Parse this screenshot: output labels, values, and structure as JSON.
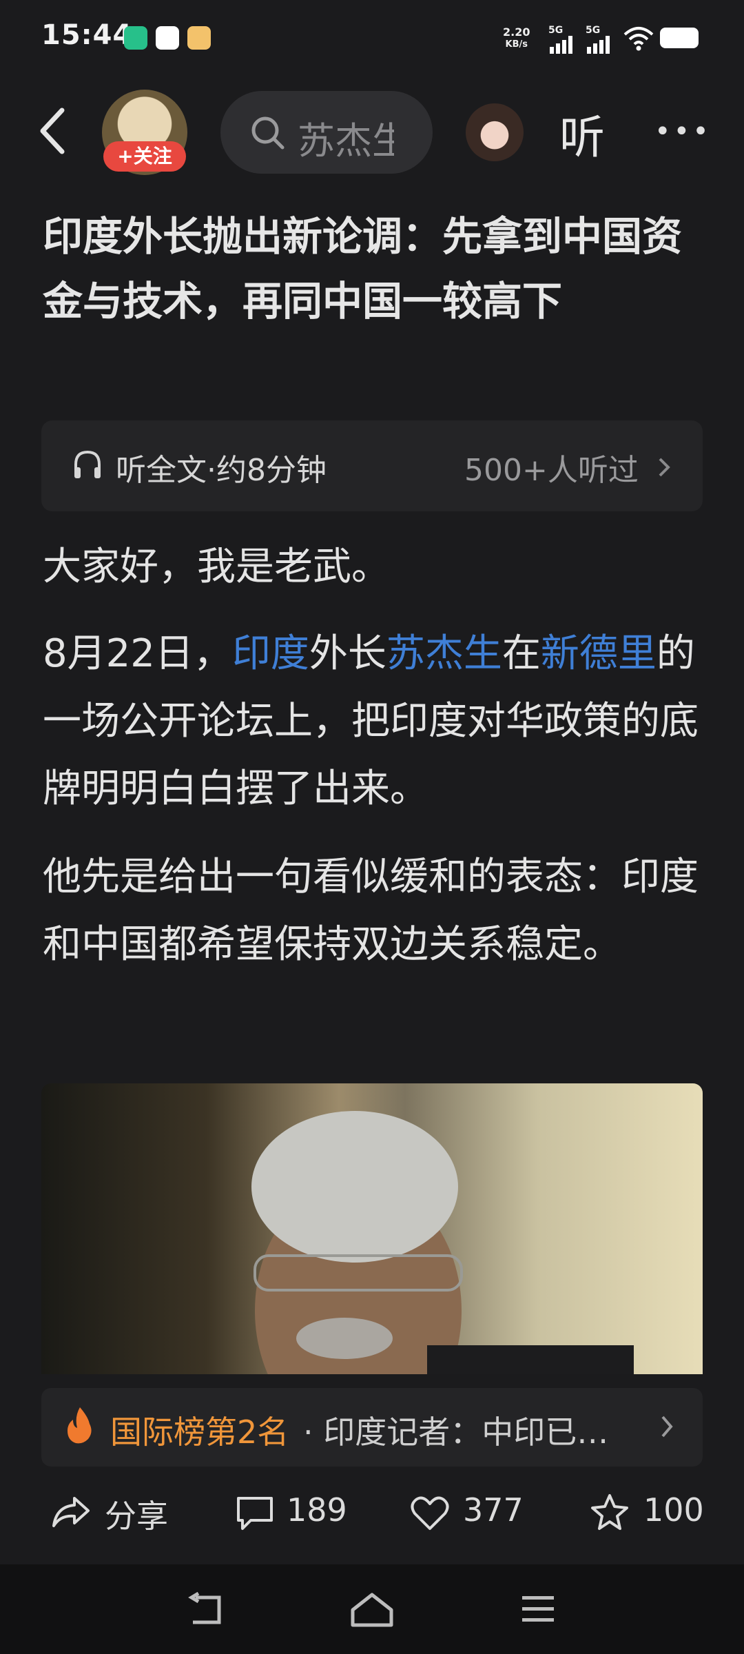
{
  "status_bar": {
    "time": "15:44",
    "net_speed_value": "2.20",
    "net_speed_unit": "KB/s",
    "signal1": "5G",
    "signal2": "5G",
    "battery_icon": "battery-icon"
  },
  "header": {
    "follow_label": "+关注",
    "search_text": "苏杰生",
    "listen_label": "听",
    "more_icon": "more-icon"
  },
  "article": {
    "title": "印度外长抛出新论调：先拿到中国资金与技术，再同中国一较高下",
    "audio_label": "听全文·约8分钟",
    "audio_count": "500+人听过",
    "para1": "大家好，我是老武。",
    "para2_a": "8月22日，",
    "para2_link1": "印度",
    "para2_b": "外长",
    "para2_link2": "苏杰生",
    "para2_c": "在",
    "para2_link3": "新德里",
    "para2_d": "的一场公开论坛上，把印度对华政策的底牌明明白白摆了出来。",
    "para3": "他先是给出一句看似缓和的表态：印度和中国都希望保持双边关系稳定。"
  },
  "ranking": {
    "title": "国际榜第2名",
    "text": "· 印度记者：中印已…"
  },
  "actions": {
    "share_label": "分享",
    "comments": "189",
    "likes": "377",
    "favorites": "100"
  },
  "colors": {
    "background": "#1b1b1d",
    "link": "#3f7fd6",
    "accent_red": "#e8483f",
    "accent_orange": "#f0963a"
  }
}
